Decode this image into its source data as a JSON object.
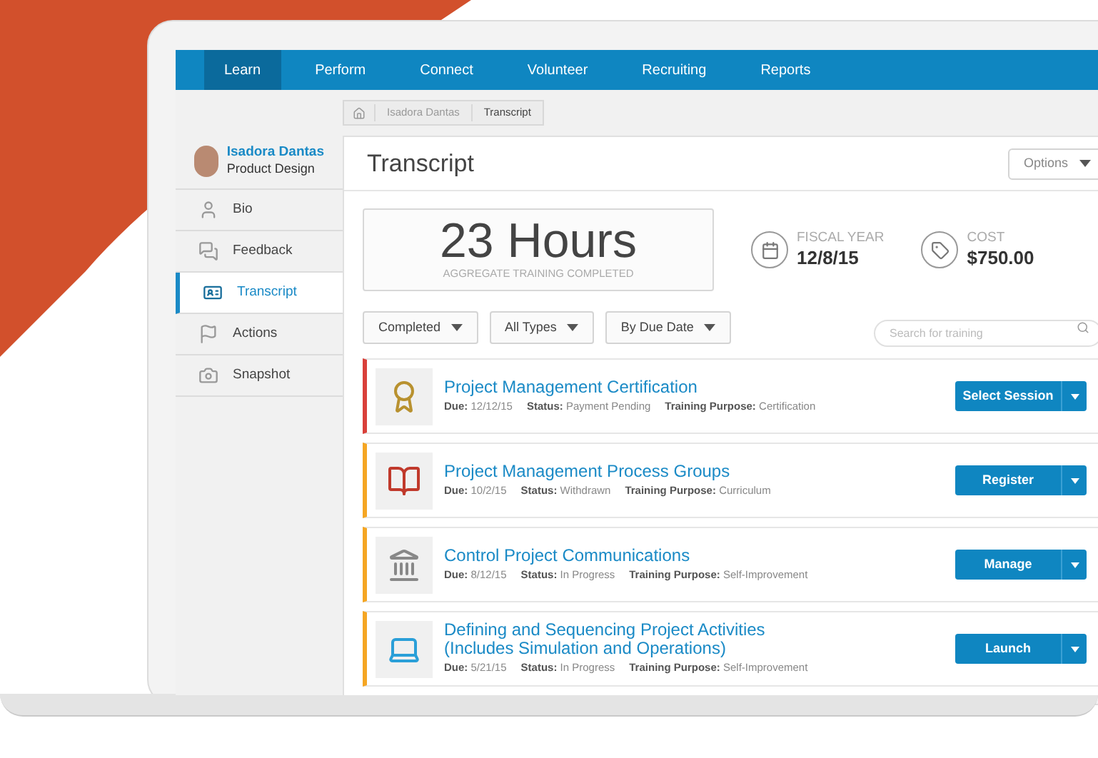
{
  "nav": [
    {
      "label": "Learn",
      "selected": true
    },
    {
      "label": "Perform",
      "selected": false
    },
    {
      "label": "Connect",
      "selected": false
    },
    {
      "label": "Volunteer",
      "selected": false
    },
    {
      "label": "Recruiting",
      "selected": false
    },
    {
      "label": "Reports",
      "selected": false
    }
  ],
  "breadcrumb": [
    "Isadora Dantas",
    "Transcript"
  ],
  "profile": {
    "name": "Isadora Dantas",
    "role": "Product Design"
  },
  "sidebar": [
    {
      "label": "Bio",
      "selected": false
    },
    {
      "label": "Feedback",
      "selected": false
    },
    {
      "label": "Transcript",
      "selected": true
    },
    {
      "label": "Actions",
      "selected": false
    },
    {
      "label": "Snapshot",
      "selected": false
    }
  ],
  "page_title": "Transcript",
  "options_button": "Options",
  "summary": {
    "hours": "23 Hours",
    "caption": "AGGREGATE TRAINING COMPLETED"
  },
  "stats": [
    {
      "label": "FISCAL YEAR",
      "value": "12/8/15"
    },
    {
      "label": "COST",
      "value": "$750.00"
    }
  ],
  "filters": [
    "Completed",
    "All Types",
    "By Due Date"
  ],
  "search": {
    "placeholder": "Search for training"
  },
  "trainings": [
    {
      "title": "Project Management Certification",
      "color": "#d9403a",
      "meta": [
        "**Due:** 12/12/15",
        "**Status:** Payment Pending",
        "**Training Purpose:** Certification"
      ],
      "action": "Select Session"
    },
    {
      "title": "Project Management Process Groups",
      "color": "#f5a623",
      "meta": [
        "**Due:** 10/2/15",
        "**Status:** Withdrawn",
        "**Training Purpose:** Curriculum"
      ],
      "action": "Register"
    },
    {
      "title": "Control Project Communications",
      "color": "#f5a623",
      "meta": [
        "**Due:** 8/12/15",
        "**Status:** In Progress",
        "**Training Purpose:** Self-Improvement"
      ],
      "action": "Manage"
    },
    {
      "title": "Defining and Sequencing Project Activities (Includes Simulation and Operations)",
      "color": "#f5a623",
      "meta": [
        "**Due:** 5/21/15",
        "**Status:** In Progress",
        "**Training Purpose:** Self-Improvement"
      ],
      "action": "Launch"
    }
  ]
}
